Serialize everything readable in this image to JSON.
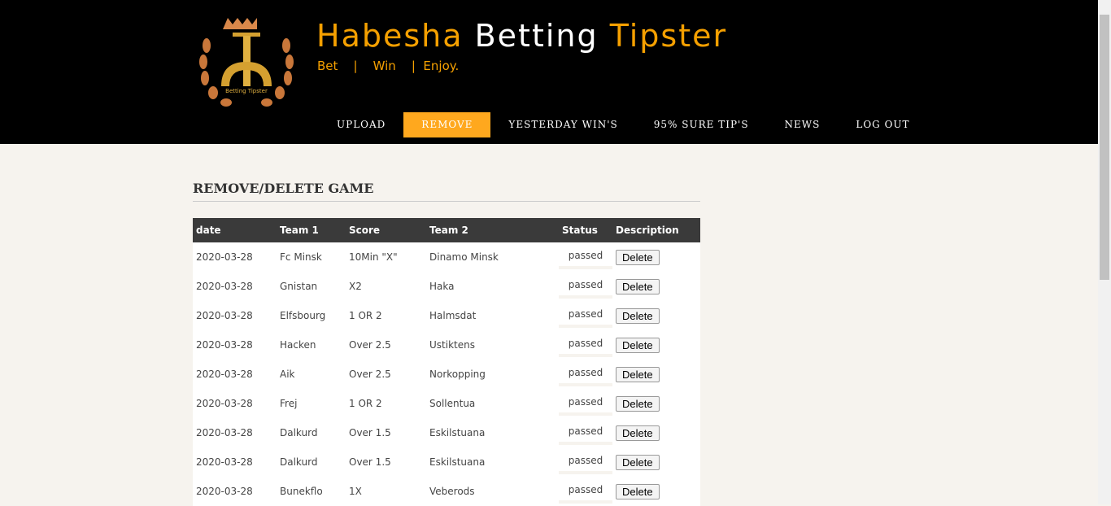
{
  "header": {
    "title_part1": "Habesha ",
    "title_part2": "Betting",
    "title_part3": " Tipster",
    "tagline": "Bet    |    Win    |  Enjoy.",
    "logo_text": "Betting Tipster"
  },
  "nav": [
    {
      "label": "UPLOAD"
    },
    {
      "label": "REMOVE",
      "active": true
    },
    {
      "label": "YESTERDAY WIN'S"
    },
    {
      "label": "95% SURE TIP'S"
    },
    {
      "label": "NEWS"
    },
    {
      "label": "LOG OUT"
    }
  ],
  "colors": {
    "accent": "#ffa81e",
    "header_bg": "#000000",
    "table_header": "#3a3a3a"
  },
  "main": {
    "heading": "REMOVE/DELETE GAME",
    "columns": [
      "date",
      "Team 1",
      "Score",
      "Team 2",
      "Status",
      "Description"
    ],
    "delete_label": "Delete",
    "rows": [
      [
        "2020-03-28",
        "Fc Minsk",
        "10Min \"X\"",
        "Dinamo Minsk",
        "passed"
      ],
      [
        "2020-03-28",
        "Gnistan",
        "X2",
        "Haka",
        "passed"
      ],
      [
        "2020-03-28",
        "Elfsbourg",
        "1 OR 2",
        "Halmsdat",
        "passed"
      ],
      [
        "2020-03-28",
        "Hacken",
        "Over 2.5",
        "Ustiktens",
        "passed"
      ],
      [
        "2020-03-28",
        "Aik",
        "Over 2.5",
        "Norkopping",
        "passed"
      ],
      [
        "2020-03-28",
        "Frej",
        "1 OR 2",
        "Sollentua",
        "passed"
      ],
      [
        "2020-03-28",
        "Dalkurd",
        "Over 1.5",
        "Eskilstuana",
        "passed"
      ],
      [
        "2020-03-28",
        "Dalkurd",
        "Over 1.5",
        "Eskilstuana",
        "passed"
      ],
      [
        "2020-03-28",
        "Bunekflo",
        "1X",
        "Veberods",
        "passed"
      ]
    ]
  }
}
